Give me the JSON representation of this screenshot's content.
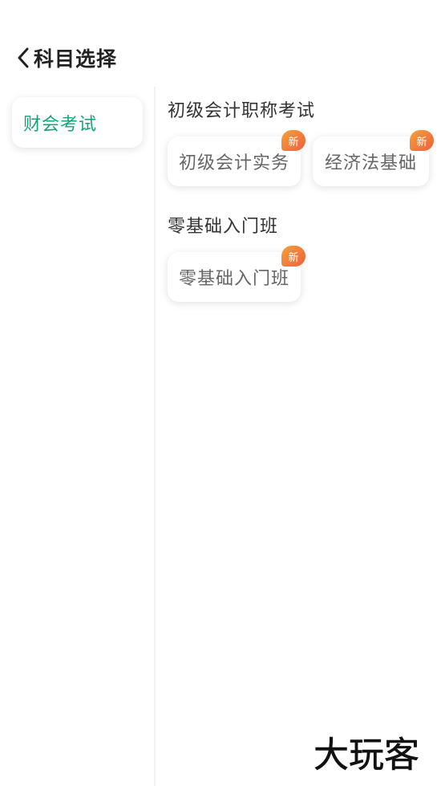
{
  "header": {
    "title": "科目选择"
  },
  "sidebar": {
    "items": [
      {
        "label": "财会考试",
        "selected": true
      }
    ]
  },
  "sections": [
    {
      "title": "初级会计职称考试",
      "subjects": [
        {
          "label": "初级会计实务",
          "badge": "新"
        },
        {
          "label": "经济法基础",
          "badge": "新"
        }
      ]
    },
    {
      "title": "零基础入门班",
      "subjects": [
        {
          "label": "零基础入门班",
          "badge": "新"
        }
      ]
    }
  ],
  "watermark": {
    "text": "大玩客"
  },
  "colors": {
    "accent": "#17a37a",
    "badge_start": "#f5a23b",
    "badge_end": "#ee5f3c",
    "title_text": "#222222",
    "card_text": "#666666"
  }
}
